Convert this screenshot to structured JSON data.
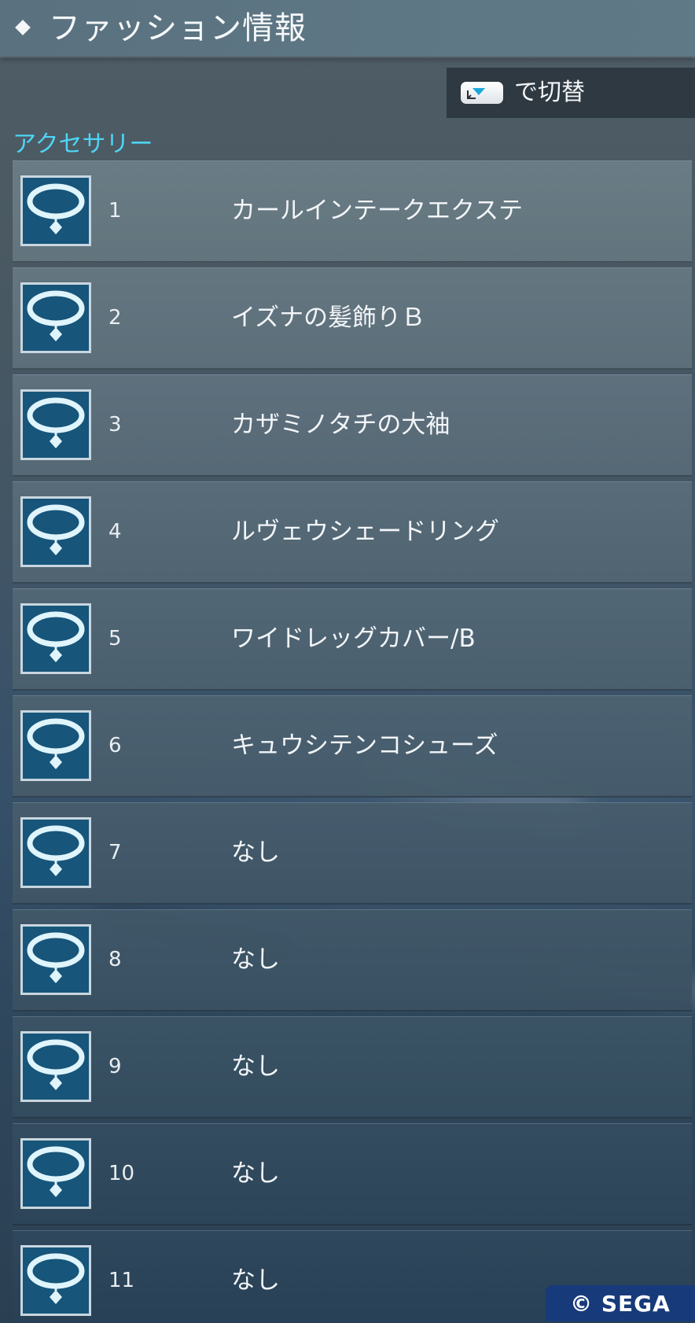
{
  "header": {
    "title": "ファッション情報",
    "diamond_icon": "diamond-icon"
  },
  "switch_hint": {
    "key_icon": "touchpad-key-icon",
    "label": "で切替"
  },
  "section": {
    "label": "アクセサリー",
    "item_icon": "necklace-icon"
  },
  "items": [
    {
      "num": "1",
      "name": "カールインテークエクステ"
    },
    {
      "num": "2",
      "name": "イズナの髪飾りＢ"
    },
    {
      "num": "3",
      "name": "カザミノタチの大袖"
    },
    {
      "num": "4",
      "name": "ルヴェウシェードリング"
    },
    {
      "num": "5",
      "name": "ワイドレッグカバー/B"
    },
    {
      "num": "6",
      "name": "キュウシテンコシューズ"
    },
    {
      "num": "7",
      "name": "なし"
    },
    {
      "num": "8",
      "name": "なし"
    },
    {
      "num": "9",
      "name": "なし"
    },
    {
      "num": "10",
      "name": "なし"
    },
    {
      "num": "11",
      "name": "なし"
    }
  ],
  "copyright": "© SEGA",
  "colors": {
    "accent": "#4fd4f5",
    "icon_bg": "#17557a",
    "header_bg": "#5e7784",
    "copyright_bg": "#173a7a"
  }
}
